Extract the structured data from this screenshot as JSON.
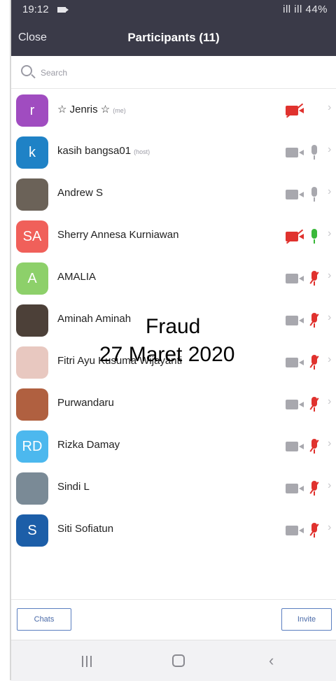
{
  "status_bar": {
    "time": "19:12",
    "right_text": "ill ill 44%"
  },
  "header": {
    "close_label": "Close",
    "title": "Participants (11)"
  },
  "search": {
    "placeholder": "Search"
  },
  "participants": [
    {
      "initials": "r",
      "name": "☆ Jenris ☆",
      "tag": "(me)",
      "avatar_color": "#a04cc0",
      "video": "off",
      "mic": "none"
    },
    {
      "initials": "k",
      "name": "kasih bangsa01",
      "tag": "(host)",
      "avatar_color": "#1f82c6",
      "video": "on",
      "mic": "unmuted"
    },
    {
      "initials": "",
      "name": "Andrew S",
      "tag": "",
      "avatar_color": "#6b6258",
      "video": "on",
      "mic": "unmuted"
    },
    {
      "initials": "SA",
      "name": "Sherry Annesa Kurniawan",
      "tag": "",
      "avatar_color": "#f0605a",
      "video": "off",
      "mic": "active"
    },
    {
      "initials": "A",
      "name": "AMALIA",
      "tag": "",
      "avatar_color": "#8dd06a",
      "video": "on",
      "mic": "muted"
    },
    {
      "initials": "",
      "name": "Aminah Aminah",
      "tag": "",
      "avatar_color": "#4c4038",
      "video": "on",
      "mic": "muted"
    },
    {
      "initials": "",
      "name": "Fitri Ayu Kusuma Wijayanti",
      "tag": "",
      "avatar_color": "#e8c8c0",
      "video": "on",
      "mic": "muted"
    },
    {
      "initials": "",
      "name": "Purwandaru",
      "tag": "",
      "avatar_color": "#b06040",
      "video": "on",
      "mic": "muted"
    },
    {
      "initials": "RD",
      "name": "Rizka Damay",
      "tag": "",
      "avatar_color": "#4cb8ee",
      "video": "on",
      "mic": "muted"
    },
    {
      "initials": "",
      "name": "Sindi L",
      "tag": "",
      "avatar_color": "#7a8a96",
      "video": "on",
      "mic": "muted"
    },
    {
      "initials": "S",
      "name": "Siti Sofiatun",
      "tag": "",
      "avatar_color": "#1c5ea8",
      "video": "on",
      "mic": "muted"
    }
  ],
  "overlay": {
    "line1": "Fraud",
    "line2": "27 Maret 2020"
  },
  "footer": {
    "chats_label": "Chats",
    "invite_label": "Invite"
  },
  "colors": {
    "header_bg": "#3a3a48",
    "muted_red": "#e0322e",
    "active_green": "#3ab83a",
    "icon_gray": "#a8a8ae"
  },
  "nav": {
    "icons": [
      "recent-apps-icon",
      "home-icon",
      "back-icon"
    ]
  }
}
